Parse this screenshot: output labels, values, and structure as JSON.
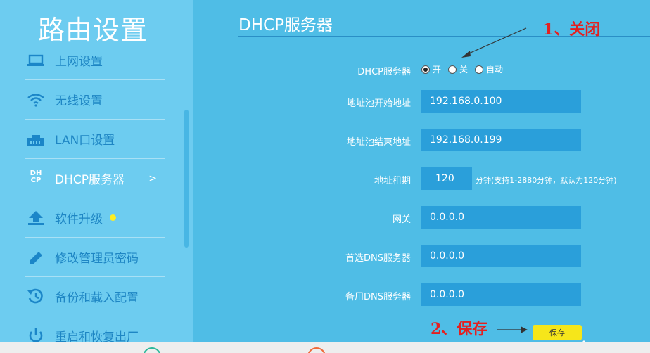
{
  "sidebar": {
    "title": "路由设置",
    "items": [
      {
        "label": "上网设置",
        "icon": "laptop-icon"
      },
      {
        "label": "无线设置",
        "icon": "wifi-icon"
      },
      {
        "label": "LAN口设置",
        "icon": "lan-port-icon"
      },
      {
        "label": "DHCP服务器",
        "icon": "dhcp-icon",
        "chevron": ">"
      },
      {
        "label": "软件升级",
        "icon": "upload-icon",
        "badge": "dot"
      },
      {
        "label": "修改管理员密码",
        "icon": "pencil-icon"
      },
      {
        "label": "备份和载入配置",
        "icon": "restore-icon"
      },
      {
        "label": "重启和恢复出厂",
        "icon": "power-icon"
      }
    ],
    "dhcp_icon_text": "DH CP"
  },
  "main": {
    "title": "DHCP服务器",
    "dhcp": {
      "label": "DHCP服务器",
      "options": [
        "开",
        "关",
        "自动"
      ],
      "selected": "开"
    },
    "pool_start": {
      "label": "地址池开始地址",
      "value": "192.168.0.100"
    },
    "pool_end": {
      "label": "地址池结束地址",
      "value": "192.168.0.199"
    },
    "lease": {
      "label": "地址租期",
      "value": "120",
      "hint": "分钟(支持1-2880分钟，默认为120分钟)"
    },
    "gateway": {
      "label": "网关",
      "value": "0.0.0.0"
    },
    "dns_primary": {
      "label": "首选DNS服务器",
      "value": "0.0.0.0"
    },
    "dns_secondary": {
      "label": "备用DNS服务器",
      "value": "0.0.0.0"
    },
    "save_label": "保存"
  },
  "annotations": {
    "step1": "1、关闭",
    "step2": "2、保存"
  },
  "colors": {
    "main_bg": "#4fbde6",
    "sidebar_bg": "#6dccf0",
    "field_bg": "#2a9fda",
    "save_bg": "#f6e61a",
    "annotation": "#e32020"
  }
}
